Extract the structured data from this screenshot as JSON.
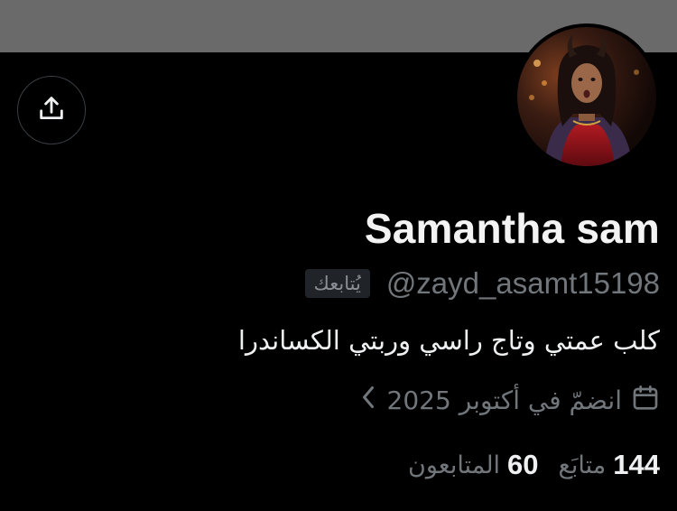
{
  "profile": {
    "display_name": "Samantha sam",
    "handle": "@zayd_asamt15198",
    "follows_you_badge": "يُتابعك",
    "bio": "كلب عمتي وتاج راسي وربتي الكساندرا",
    "joined": "انضمّ في أكتوبر 2025",
    "following_count": "144",
    "following_label": "متابَع",
    "followers_count": "60",
    "followers_label": "المتابعون"
  },
  "icons": {
    "share": "share-upload-icon",
    "calendar": "calendar-icon",
    "chevron": "chevron-left-icon"
  },
  "colors": {
    "background": "#000000",
    "banner": "#6a6a6a",
    "text_primary": "#e7e9ea",
    "text_secondary": "#71767b",
    "badge_bg": "#202327"
  }
}
